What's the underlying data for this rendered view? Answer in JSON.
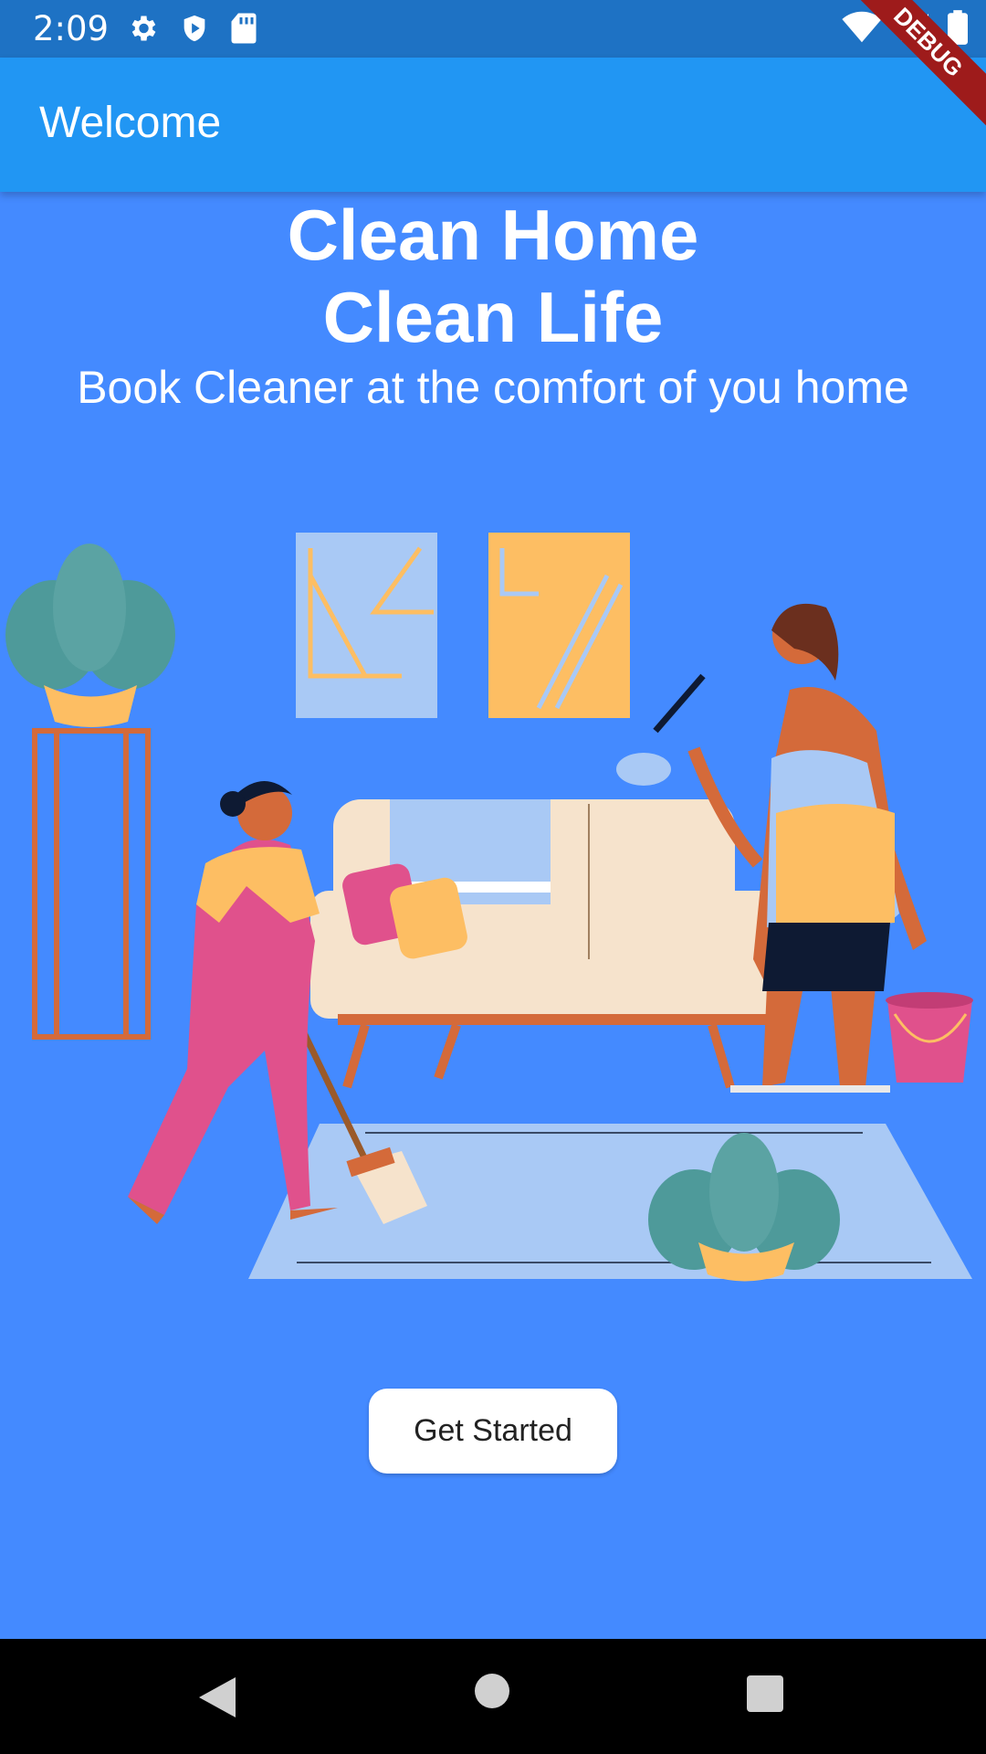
{
  "status_bar": {
    "time": "2:09",
    "icons_left": [
      "settings-icon",
      "shield-icon",
      "sd-card-icon"
    ],
    "icons_right": [
      "wifi-icon",
      "signal-icon",
      "battery-icon"
    ]
  },
  "app_bar": {
    "title": "Welcome"
  },
  "debug_banner": "DEBUG",
  "hero": {
    "title_line1": "Clean Home",
    "title_line2": "Clean Life",
    "subtitle": "Book Cleaner at the comfort of you home"
  },
  "cta": {
    "label": "Get Started"
  },
  "nav_bar": {
    "icons": [
      "back-icon",
      "home-icon",
      "recents-icon"
    ]
  }
}
